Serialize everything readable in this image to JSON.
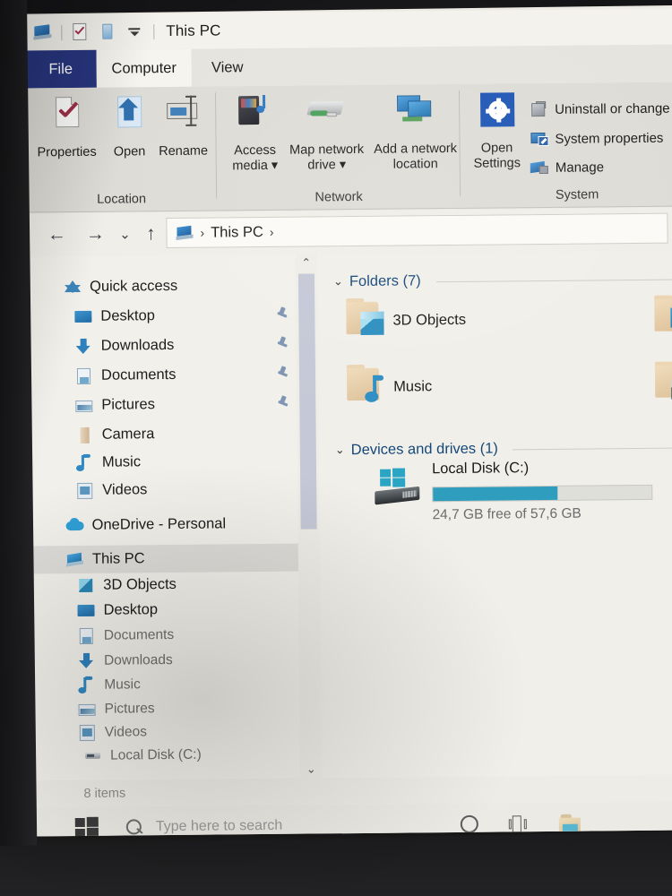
{
  "window": {
    "title": "This PC",
    "quick_access_toolbar": [
      {
        "name": "this-pc-icon",
        "label": "This PC"
      },
      {
        "name": "properties-icon",
        "label": "Properties"
      },
      {
        "name": "new-folder-icon",
        "label": "New folder"
      },
      {
        "name": "customize-dropdown-icon",
        "label": "Customize Quick Access Toolbar"
      }
    ]
  },
  "ribbon": {
    "tabs": [
      {
        "label": "File",
        "state": "file-menu"
      },
      {
        "label": "Computer",
        "state": "active"
      },
      {
        "label": "View",
        "state": "inactive"
      }
    ],
    "groups": [
      {
        "label": "Location",
        "buttons": [
          {
            "label": "Properties",
            "icon": "properties-icon"
          },
          {
            "label": "Open",
            "icon": "open-icon"
          },
          {
            "label": "Rename",
            "icon": "rename-icon"
          }
        ]
      },
      {
        "label": "Network",
        "buttons": [
          {
            "label": "Access media",
            "icon": "access-media-icon",
            "dropdown": true
          },
          {
            "label": "Map network drive",
            "icon": "map-network-drive-icon",
            "dropdown": true
          },
          {
            "label": "Add a network location",
            "icon": "add-network-location-icon",
            "dropdown": false
          }
        ]
      },
      {
        "label": "System",
        "buttons": [
          {
            "label": "Open Settings",
            "icon": "settings-gear-icon"
          }
        ],
        "small_buttons": [
          {
            "label": "Uninstall or change a prog",
            "icon": "uninstall-icon"
          },
          {
            "label": "System properties",
            "icon": "system-properties-icon"
          },
          {
            "label": "Manage",
            "icon": "manage-icon"
          }
        ]
      }
    ]
  },
  "navigation": {
    "back": "←",
    "forward": "→",
    "recent": "⌄",
    "up": "↑",
    "breadcrumb": {
      "icon": "this-pc-icon",
      "separator": "›",
      "items": [
        "This PC"
      ],
      "trailing_separator": "›"
    }
  },
  "sidebar": {
    "items": [
      {
        "label": "Quick access",
        "icon": "star-icon",
        "indent": 0,
        "pinned": false,
        "selected": false,
        "dim": false
      },
      {
        "label": "Desktop",
        "icon": "desktop-icon",
        "indent": 1,
        "pinned": true,
        "selected": false,
        "dim": false
      },
      {
        "label": "Downloads",
        "icon": "downloads-icon",
        "indent": 1,
        "pinned": true,
        "selected": false,
        "dim": false
      },
      {
        "label": "Documents",
        "icon": "documents-icon",
        "indent": 1,
        "pinned": true,
        "selected": false,
        "dim": false
      },
      {
        "label": "Pictures",
        "icon": "pictures-icon",
        "indent": 1,
        "pinned": true,
        "selected": false,
        "dim": false
      },
      {
        "label": "Camera",
        "icon": "camera-folder-icon",
        "indent": 1,
        "pinned": false,
        "selected": false,
        "dim": false
      },
      {
        "label": "Music",
        "icon": "music-icon",
        "indent": 1,
        "pinned": false,
        "selected": false,
        "dim": false
      },
      {
        "label": "Videos",
        "icon": "videos-icon",
        "indent": 1,
        "pinned": false,
        "selected": false,
        "dim": false
      },
      {
        "label": "OneDrive - Personal",
        "icon": "onedrive-cloud-icon",
        "indent": 0,
        "pinned": false,
        "selected": false,
        "dim": false
      },
      {
        "label": "This PC",
        "icon": "this-pc-icon",
        "indent": 0,
        "pinned": false,
        "selected": true,
        "dim": false
      },
      {
        "label": "3D Objects",
        "icon": "3d-objects-icon",
        "indent": 1,
        "pinned": false,
        "selected": false,
        "dim": false
      },
      {
        "label": "Desktop",
        "icon": "desktop-icon",
        "indent": 1,
        "pinned": false,
        "selected": false,
        "dim": false
      },
      {
        "label": "Documents",
        "icon": "documents-icon",
        "indent": 1,
        "pinned": false,
        "selected": false,
        "dim": true
      },
      {
        "label": "Downloads",
        "icon": "downloads-icon",
        "indent": 1,
        "pinned": false,
        "selected": false,
        "dim": true
      },
      {
        "label": "Music",
        "icon": "music-icon",
        "indent": 1,
        "pinned": false,
        "selected": false,
        "dim": true
      },
      {
        "label": "Pictures",
        "icon": "pictures-icon",
        "indent": 1,
        "pinned": false,
        "selected": false,
        "dim": true
      },
      {
        "label": "Videos",
        "icon": "videos-icon",
        "indent": 1,
        "pinned": false,
        "selected": false,
        "dim": true
      },
      {
        "label": "Local Disk (C:)",
        "icon": "local-disk-icon",
        "indent": 1,
        "pinned": false,
        "selected": false,
        "dim": true
      }
    ],
    "scrollbar": {
      "up_arrow": "⌃",
      "down_arrow": "⌄"
    }
  },
  "content": {
    "groups": [
      {
        "label": "Folders (7)",
        "chevron": "⌄"
      },
      {
        "label": "Devices and drives (1)",
        "chevron": "⌄"
      }
    ],
    "folders": [
      {
        "label": "3D Objects",
        "icon": "folder-3d-objects-icon"
      },
      {
        "label": "Music",
        "icon": "folder-music-icon"
      },
      {
        "label": "",
        "icon": "folder-desktop-icon"
      },
      {
        "label": "",
        "icon": "folder-pictures-icon"
      }
    ],
    "drives": [
      {
        "label": "Local Disk (C:)",
        "icon": "local-disk-windows-icon",
        "free_text": "24,7 GB free of 57,6 GB",
        "used_percent": 57,
        "bar_color": "#2f9ebe"
      }
    ]
  },
  "statusbar": {
    "item_count": "8 items"
  },
  "taskbar": {
    "start_label": "Start",
    "search_placeholder": "Type here to search",
    "buttons": [
      {
        "name": "cortana-icon",
        "label": "Cortana"
      },
      {
        "name": "task-view-icon",
        "label": "Task View"
      },
      {
        "name": "file-explorer-icon",
        "label": "File Explorer"
      }
    ]
  },
  "colors": {
    "file_tab": "#27357e",
    "accent_link": "#15487a",
    "drive_bar": "#2f9ebe"
  }
}
